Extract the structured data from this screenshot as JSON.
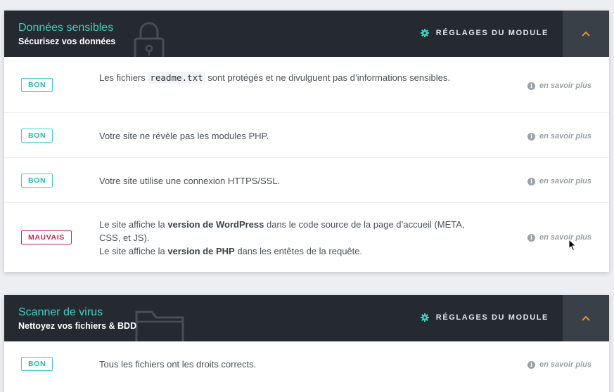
{
  "modules": [
    {
      "title": "Données sensibles",
      "subtitle": "Sécurisez vos données",
      "settings_label": "RÉGLAGES DU MODULE",
      "bg_icon": "lock-icon",
      "rows": [
        {
          "status": "BON",
          "text_before": "Les fichiers ",
          "code": "readme.txt",
          "text_after": " sont protégés et ne divulguent pas d’informations sensibles.",
          "link": "en savoir plus"
        },
        {
          "status": "BON",
          "text": "Votre site ne révèle pas les modules PHP.",
          "link": "en savoir plus"
        },
        {
          "status": "BON",
          "text": "Votre site utilise une connexion HTTPS/SSL.",
          "link": "en savoir plus"
        },
        {
          "status": "MAUVAIS",
          "line1_a": "Le site affiche la ",
          "line1_b": "version de WordPress",
          "line1_c": " dans le code source de la page d’accueil (META, CSS, et JS).",
          "line2_a": "Le site affiche la ",
          "line2_b": "version de PHP",
          "line2_c": " dans les entêtes de la requête.",
          "link": "en savoir plus"
        }
      ]
    },
    {
      "title": "Scanner de virus",
      "subtitle": "Nettoyez vos fichiers & BDD",
      "settings_label": "RÉGLAGES DU MODULE",
      "bg_icon": "folder-icon",
      "rows": [
        {
          "status": "BON",
          "text": "Tous les fichiers ont les droits corrects.",
          "link": "en savoir plus"
        }
      ]
    }
  ],
  "colors": {
    "accent": "#40d2c0",
    "header_bg": "#252a30",
    "toggle_bg": "#3a4047",
    "bad": "#cc2955",
    "chevron": "#f0a030"
  }
}
